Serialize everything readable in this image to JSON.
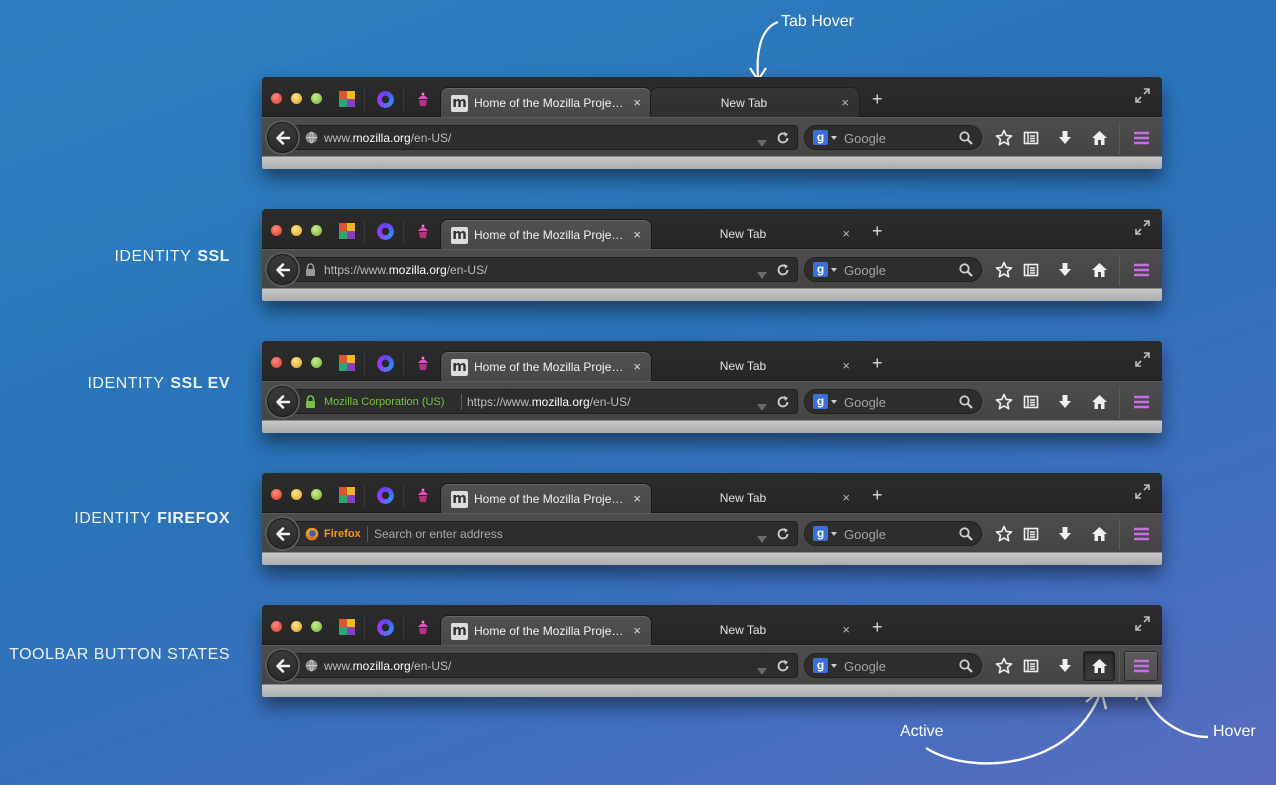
{
  "annotations": {
    "tab_hover": "Tab Hover",
    "active": "Active",
    "hover": "Hover"
  },
  "row_labels": [
    {
      "prefix": "",
      "emphasis": ""
    },
    {
      "prefix": "IDENTITY",
      "emphasis": "SSL"
    },
    {
      "prefix": "IDENTITY",
      "emphasis": "SSL EV"
    },
    {
      "prefix": "IDENTITY",
      "emphasis": "FIREFOX"
    },
    {
      "prefix": "TOOLBAR BUTTON STATES",
      "emphasis": ""
    }
  ],
  "tabs": {
    "active_title": "Home of the Mozilla Proje…",
    "active_favicon": "m",
    "second_title": "New Tab",
    "close_glyph": "×",
    "new_tab_glyph": "+"
  },
  "urls": {
    "row1": {
      "pre": "www.",
      "host": "mozilla.org",
      "post": "/en-US/"
    },
    "row2": {
      "pre": "https://www.",
      "host": "mozilla.org",
      "post": "/en-US/"
    },
    "row3": {
      "identity": "Mozilla Corporation (US)",
      "pre": "https://www.",
      "host": "mozilla.org",
      "post": "/en-US/"
    },
    "row4": {
      "identity": "Firefox",
      "placeholder": "Search or enter address"
    },
    "row5": {
      "pre": "www.",
      "host": "mozilla.org",
      "post": "/en-US/"
    }
  },
  "search": {
    "engine_letter": "g",
    "placeholder": "Google"
  },
  "colors": {
    "ev_green": "#74c441",
    "firefox_orange": "#f19a1b",
    "menu_purple": "#c96ee8"
  },
  "icons": [
    "back-arrow-icon",
    "globe-icon",
    "lock-icon",
    "firefox-icon",
    "dropdown-icon",
    "reload-icon",
    "search-icon",
    "star-icon",
    "bookmarks-icon",
    "download-icon",
    "home-icon",
    "menu-icon",
    "fullscreen-icon"
  ]
}
